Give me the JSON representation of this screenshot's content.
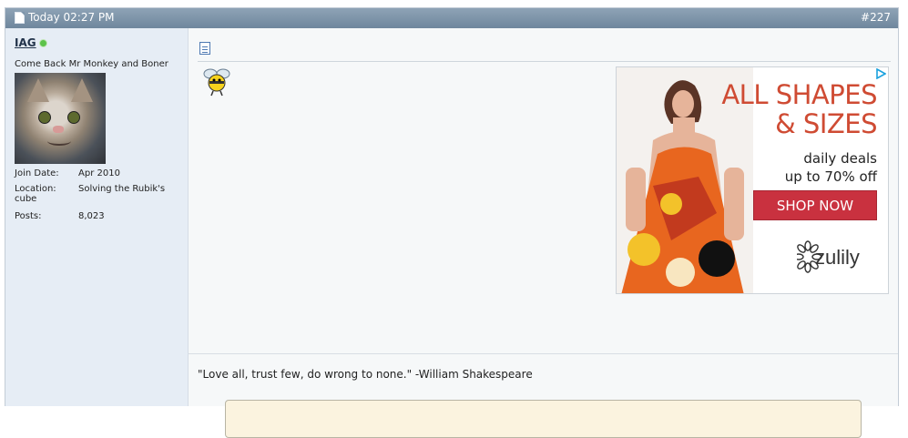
{
  "post": {
    "date": "Today 02:27 PM",
    "number": "#227"
  },
  "user": {
    "name": "IAG",
    "status": "online",
    "title": "Come Back Mr Monkey and Boner",
    "stats": [
      {
        "label": "Join Date:",
        "value": "Apr 2010"
      },
      {
        "label": "Location:",
        "value": "Solving the Rubik's cube"
      },
      {
        "label": "Posts:",
        "value": "8,023"
      }
    ]
  },
  "ad": {
    "headline_line1": "ALL SHAPES",
    "headline_line2": "& SIZES",
    "sub_line1": "daily deals",
    "sub_line2": "up to 70% off",
    "cta": "SHOP NOW",
    "brand": "zulily"
  },
  "signature": "\"Love all, trust few, do wrong to none.\" -William Shakespeare",
  "icons": [
    "document-icon",
    "message-icon",
    "bee-smiley-icon",
    "ad-choices-icon",
    "zulily-flower-icon"
  ],
  "colors": {
    "header": "#7d94aa",
    "sidebar": "#e6edf5",
    "accent_ad": "#cf4b33",
    "cta": "#c9313f",
    "online": "#5cc24a"
  }
}
